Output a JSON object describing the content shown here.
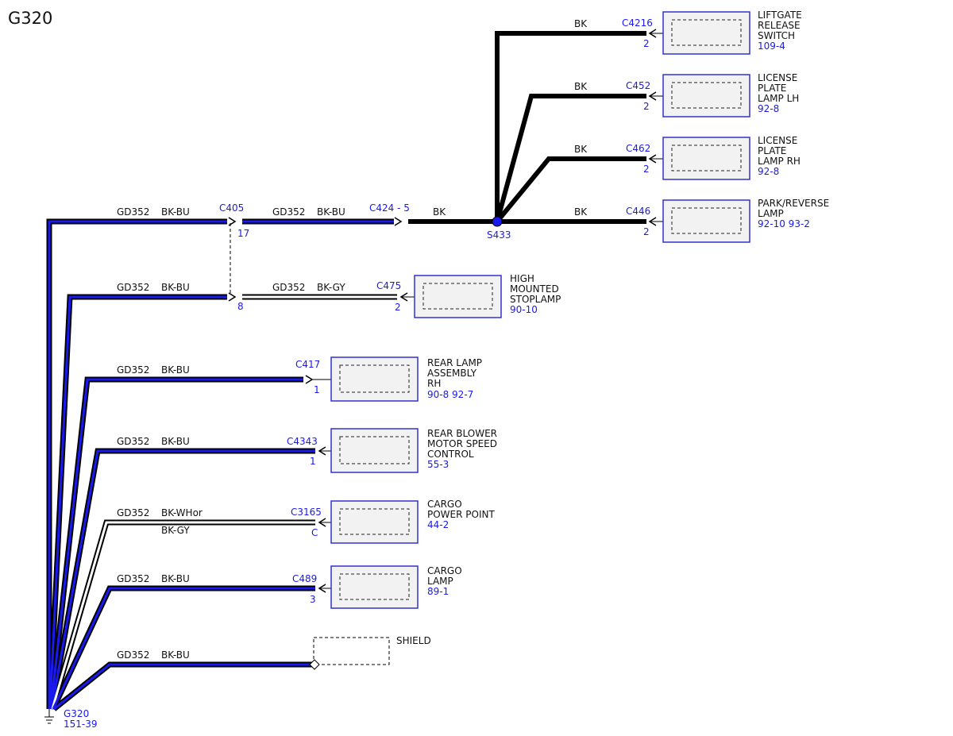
{
  "title": "G320",
  "ground": {
    "label": "G320",
    "ref": "151-39"
  },
  "splice": {
    "label": "S433"
  },
  "colors": {
    "blue_wire": "#1a1aee",
    "black": "#000000",
    "ref_text": "#1a1aee"
  },
  "wires": {
    "w1": {
      "circuit": "GD352",
      "color": "BK-BU"
    },
    "w2": {
      "circuit": "GD352",
      "color": "BK-BU"
    },
    "w3": {
      "circuit": "GD352",
      "color": "BK-BU"
    },
    "w4": {
      "circuit": "GD352",
      "color": "BK-BU"
    },
    "w5": {
      "circuit": "GD352",
      "color": "BK-WHor",
      "color2": "BK-GY"
    },
    "w6": {
      "circuit": "GD352",
      "color": "BK-BU"
    },
    "w7": {
      "circuit": "GD352",
      "color": "BK-BU"
    },
    "w1b": {
      "circuit": "GD352",
      "color": "BK-BU"
    },
    "w2b": {
      "circuit": "GD352",
      "color": "BK-GY"
    },
    "bk_c424": {
      "color": "BK"
    },
    "bk_c4216": {
      "color": "BK"
    },
    "bk_c452": {
      "color": "BK"
    },
    "bk_c462": {
      "color": "BK"
    },
    "bk_c446": {
      "color": "BK"
    }
  },
  "inline_connectors": {
    "c405": {
      "name": "C405",
      "pin_top": "17",
      "pin_bottom": "8"
    },
    "c424": {
      "name": "C424 - 5"
    }
  },
  "components": {
    "c4216": {
      "connector": "C4216",
      "pin": "2",
      "lines": [
        "LIFTGATE",
        "RELEASE",
        "SWITCH"
      ],
      "refs": "109-4"
    },
    "c452": {
      "connector": "C452",
      "pin": "2",
      "lines": [
        "LICENSE",
        "PLATE",
        "LAMP LH"
      ],
      "refs": "92-8"
    },
    "c462": {
      "connector": "C462",
      "pin": "2",
      "lines": [
        "LICENSE",
        "PLATE",
        "LAMP RH"
      ],
      "refs": "92-8"
    },
    "c446": {
      "connector": "C446",
      "pin": "2",
      "lines": [
        "PARK/REVERSE",
        "LAMP"
      ],
      "refs": "92-10 93-2"
    },
    "c475": {
      "connector": "C475",
      "pin": "2",
      "lines": [
        "HIGH",
        "MOUNTED",
        "STOPLAMP"
      ],
      "refs": "90-10"
    },
    "c417": {
      "connector": "C417",
      "pin": "1",
      "lines": [
        "REAR LAMP",
        "ASSEMBLY",
        "RH"
      ],
      "refs": "90-8  92-7"
    },
    "c4343": {
      "connector": "C4343",
      "pin": "1",
      "lines": [
        "REAR BLOWER",
        "MOTOR SPEED",
        "CONTROL"
      ],
      "refs": "55-3"
    },
    "c3165": {
      "connector": "C3165",
      "pin": "C",
      "lines": [
        "CARGO",
        "POWER POINT"
      ],
      "refs": "44-2"
    },
    "c489": {
      "connector": "C489",
      "pin": "3",
      "lines": [
        "CARGO",
        "LAMP"
      ],
      "refs": "89-1"
    }
  },
  "shield": {
    "label": "SHIELD"
  }
}
